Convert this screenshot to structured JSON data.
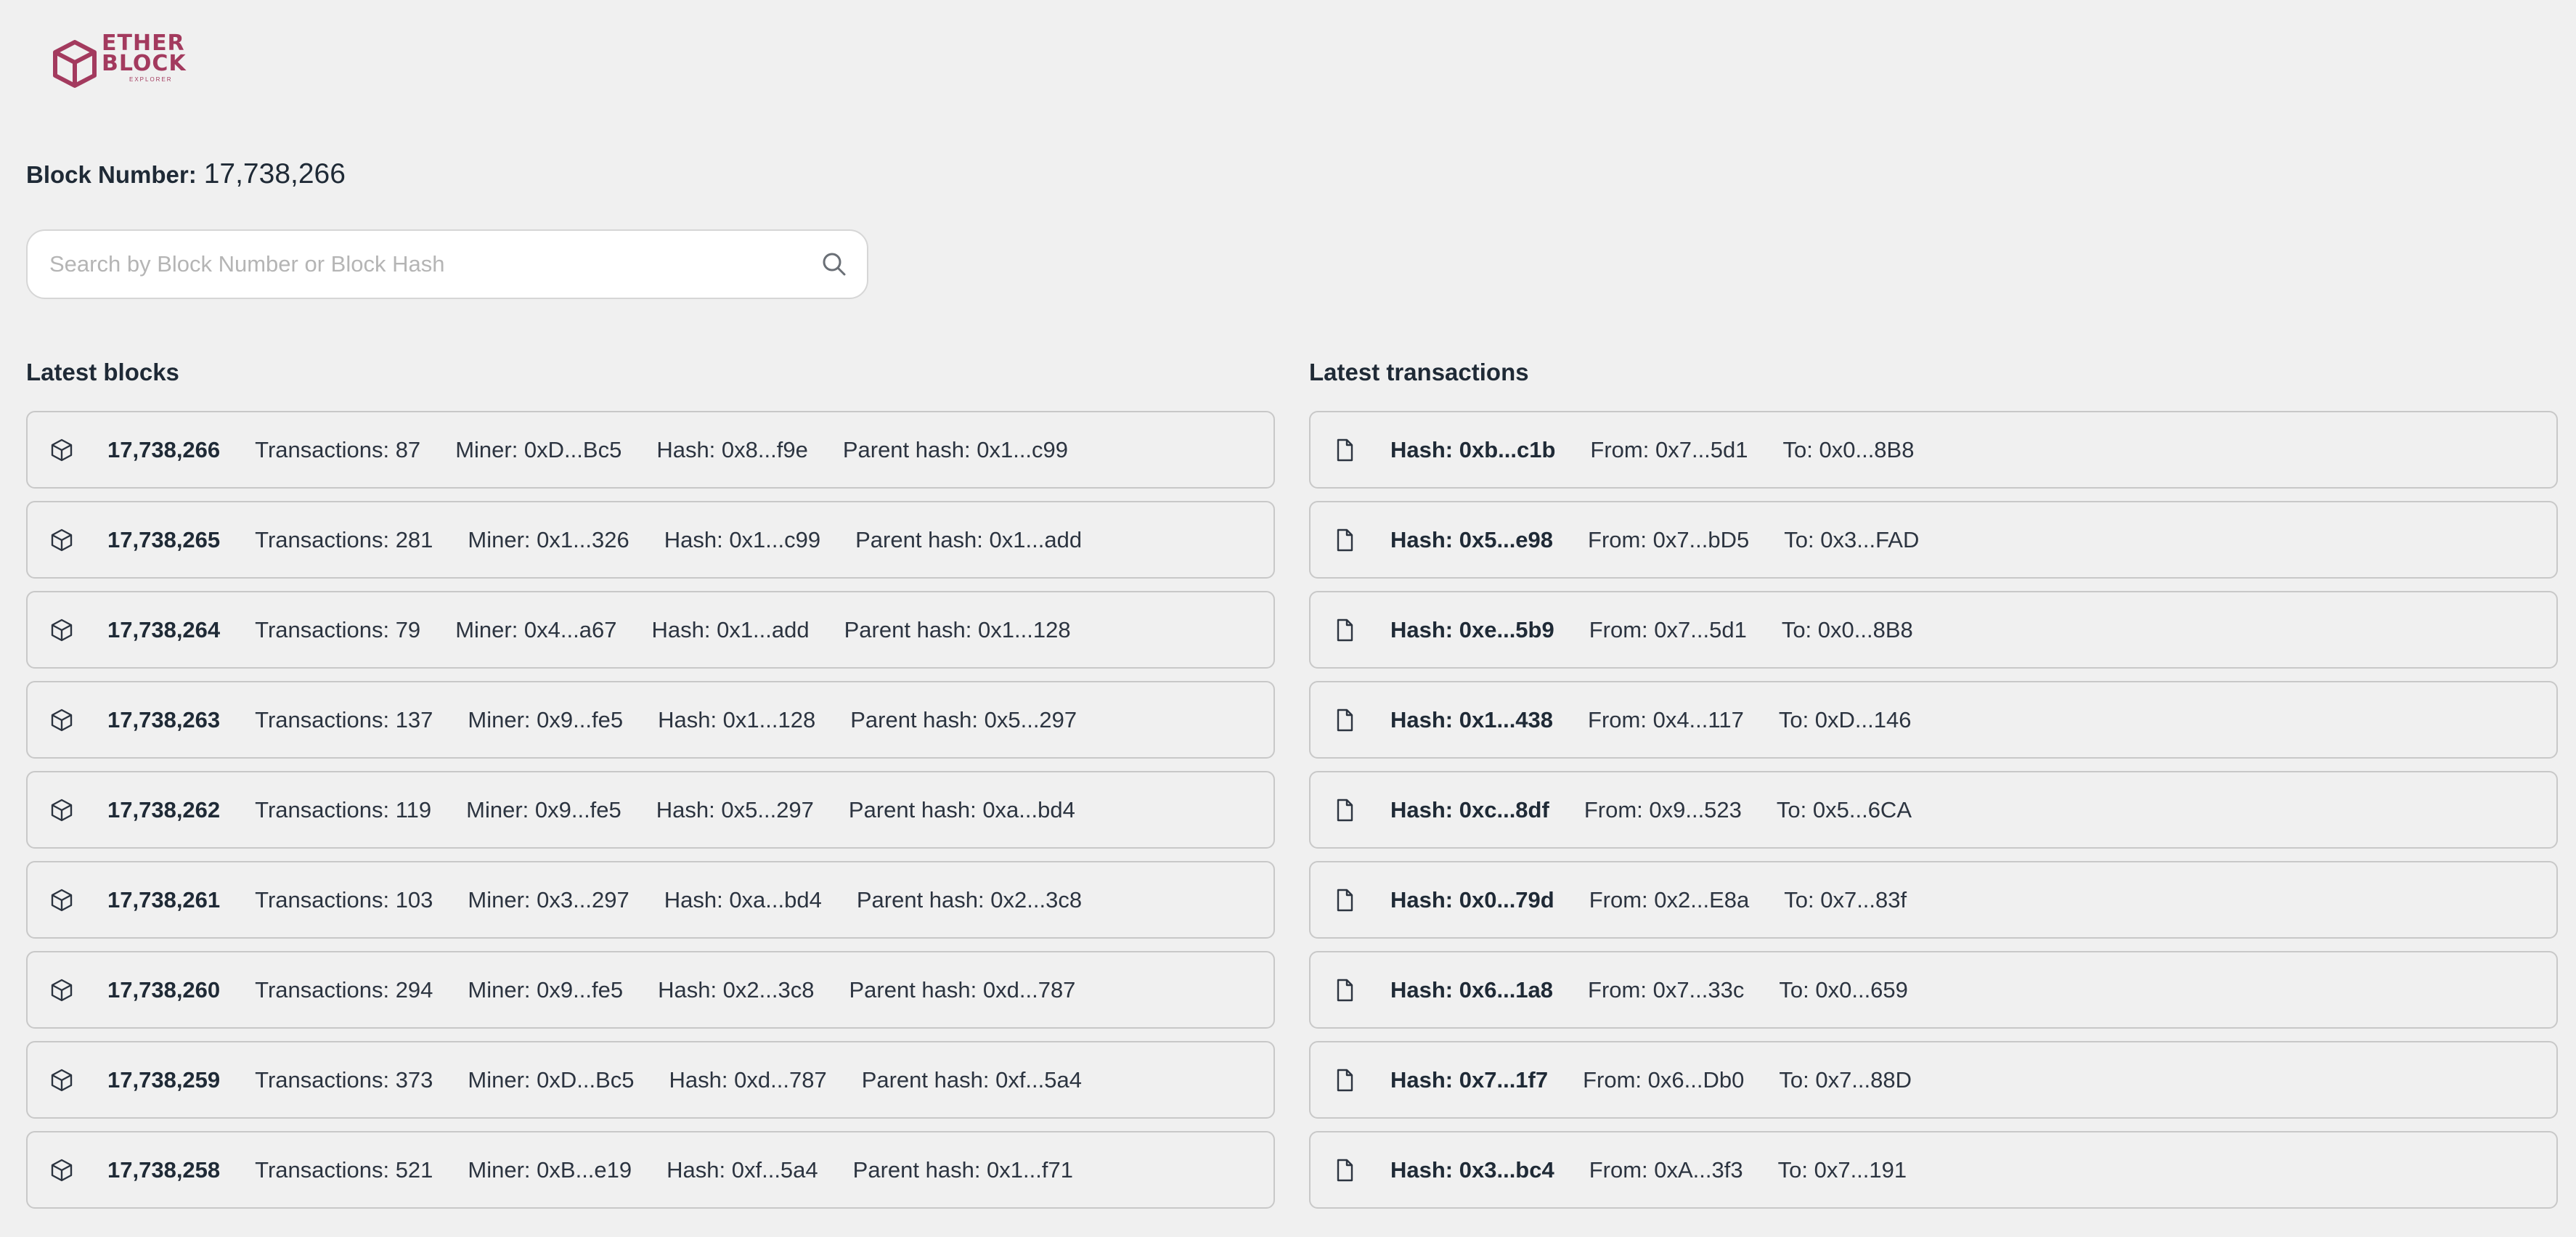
{
  "logo": {
    "line1": "ETHER",
    "line2": "BLOCK",
    "sub": "EXPLORER"
  },
  "block_number": {
    "label": "Block Number:",
    "value": "17,738,266"
  },
  "search": {
    "placeholder": "Search by Block Number or Block Hash",
    "value": ""
  },
  "latest_blocks": {
    "title": "Latest blocks",
    "items": [
      {
        "number": "17,738,266",
        "transactions": "Transactions: 87",
        "miner": "Miner: 0xD...Bc5",
        "hash": "Hash: 0x8...f9e",
        "parent": "Parent hash: 0x1...c99"
      },
      {
        "number": "17,738,265",
        "transactions": "Transactions: 281",
        "miner": "Miner: 0x1...326",
        "hash": "Hash: 0x1...c99",
        "parent": "Parent hash: 0x1...add"
      },
      {
        "number": "17,738,264",
        "transactions": "Transactions: 79",
        "miner": "Miner: 0x4...a67",
        "hash": "Hash: 0x1...add",
        "parent": "Parent hash: 0x1...128"
      },
      {
        "number": "17,738,263",
        "transactions": "Transactions: 137",
        "miner": "Miner: 0x9...fe5",
        "hash": "Hash: 0x1...128",
        "parent": "Parent hash: 0x5...297"
      },
      {
        "number": "17,738,262",
        "transactions": "Transactions: 119",
        "miner": "Miner: 0x9...fe5",
        "hash": "Hash: 0x5...297",
        "parent": "Parent hash: 0xa...bd4"
      },
      {
        "number": "17,738,261",
        "transactions": "Transactions: 103",
        "miner": "Miner: 0x3...297",
        "hash": "Hash: 0xa...bd4",
        "parent": "Parent hash: 0x2...3c8"
      },
      {
        "number": "17,738,260",
        "transactions": "Transactions: 294",
        "miner": "Miner: 0x9...fe5",
        "hash": "Hash: 0x2...3c8",
        "parent": "Parent hash: 0xd...787"
      },
      {
        "number": "17,738,259",
        "transactions": "Transactions: 373",
        "miner": "Miner: 0xD...Bc5",
        "hash": "Hash: 0xd...787",
        "parent": "Parent hash: 0xf...5a4"
      },
      {
        "number": "17,738,258",
        "transactions": "Transactions: 521",
        "miner": "Miner: 0xB...e19",
        "hash": "Hash: 0xf...5a4",
        "parent": "Parent hash: 0x1...f71"
      }
    ]
  },
  "latest_transactions": {
    "title": "Latest transactions",
    "items": [
      {
        "hash": "Hash: 0xb...c1b",
        "from": "From: 0x7...5d1",
        "to": "To: 0x0...8B8"
      },
      {
        "hash": "Hash: 0x5...e98",
        "from": "From: 0x7...bD5",
        "to": "To: 0x3...FAD"
      },
      {
        "hash": "Hash: 0xe...5b9",
        "from": "From: 0x7...5d1",
        "to": "To: 0x0...8B8"
      },
      {
        "hash": "Hash: 0x1...438",
        "from": "From: 0x4...117",
        "to": "To: 0xD...146"
      },
      {
        "hash": "Hash: 0xc...8df",
        "from": "From: 0x9...523",
        "to": "To: 0x5...6CA"
      },
      {
        "hash": "Hash: 0x0...79d",
        "from": "From: 0x2...E8a",
        "to": "To: 0x7...83f"
      },
      {
        "hash": "Hash: 0x6...1a8",
        "from": "From: 0x7...33c",
        "to": "To: 0x0...659"
      },
      {
        "hash": "Hash: 0x7...1f7",
        "from": "From: 0x6...Db0",
        "to": "To: 0x7...88D"
      },
      {
        "hash": "Hash: 0x3...bc4",
        "from": "From: 0xA...3f3",
        "to": "To: 0x7...191"
      }
    ]
  },
  "icons": {
    "block": "cube-icon",
    "transaction": "document-icon",
    "search": "search-icon"
  },
  "colors": {
    "brand": "#a33a5e",
    "background": "#f0f0f0",
    "text": "#1f2a36"
  }
}
